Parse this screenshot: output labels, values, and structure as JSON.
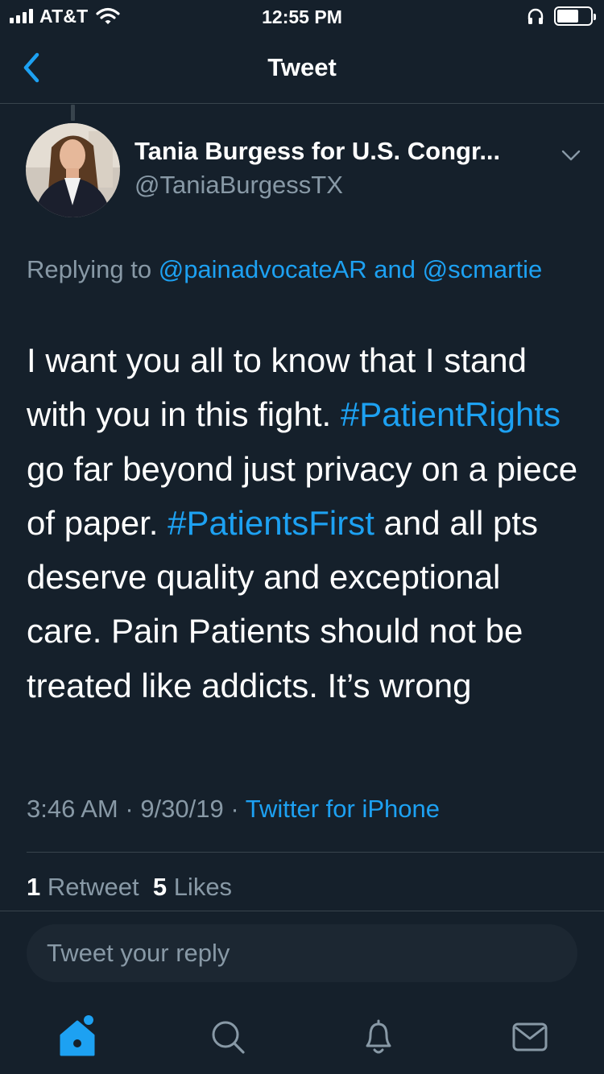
{
  "status_bar": {
    "carrier": "AT&T",
    "time": "12:55 PM",
    "signal_icon": "signal-bars-icon",
    "wifi_icon": "wifi-icon",
    "headphones_icon": "headphones-icon",
    "battery_icon": "battery-icon",
    "battery_level": 0.65
  },
  "nav": {
    "title": "Tweet",
    "back_icon": "chevron-left-icon"
  },
  "author": {
    "display_name": "Tania Burgess for U.S. Congr...",
    "handle": "@TaniaBurgessTX",
    "menu_icon": "chevron-down-icon"
  },
  "reply_context": {
    "prefix": "Replying to ",
    "mention1": "@painadvocateAR",
    "conjunction": " and ",
    "mention2": "@scmartie"
  },
  "tweet": {
    "text1": "I want you all to know that I stand with you in this fight. ",
    "hashtag1": "#PatientRights",
    "text2": " go far beyond just privacy on a piece of paper. ",
    "hashtag2": "#PatientsFirst",
    "text3": " and all pts deserve quality and exceptional care. Pain Patients should not be treated like addicts. It’s wrong"
  },
  "meta": {
    "time": "3:46 AM",
    "sep1": " · ",
    "date": "9/30/19",
    "sep2": " · ",
    "source": "Twitter for iPhone"
  },
  "stats": {
    "retweets_count": "1",
    "retweets_label": " Retweet",
    "likes_count": "5",
    "likes_label": " Likes"
  },
  "reply_box": {
    "placeholder": "Tweet your reply"
  },
  "tab_bar": {
    "items": [
      "home-icon",
      "search-icon",
      "notifications-bell-icon",
      "messages-envelope-icon"
    ],
    "accent": "#1da1f2",
    "inactive": "#8899a6"
  },
  "colors": {
    "background": "#15202b",
    "accent": "#1da1f2",
    "secondary_text": "#8899a6",
    "divider": "#38444d"
  }
}
